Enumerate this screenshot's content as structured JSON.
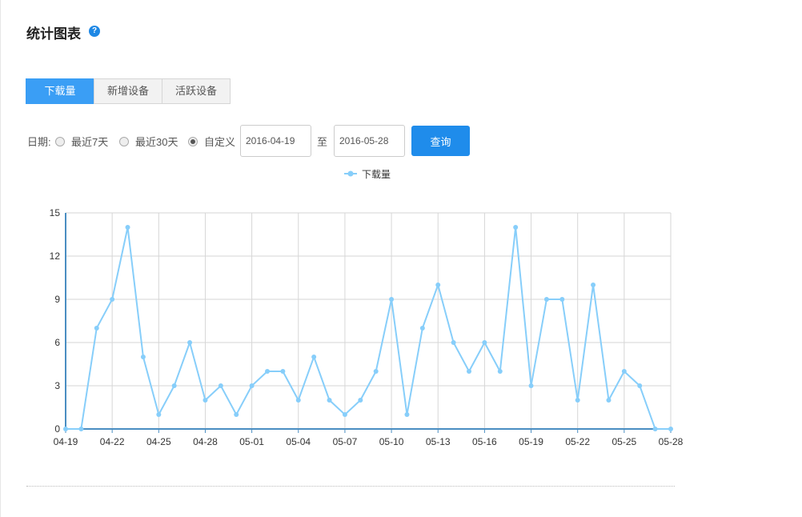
{
  "header": {
    "title": "统计图表",
    "help_glyph": "?"
  },
  "tabs": [
    {
      "label": "下载量",
      "active": true
    },
    {
      "label": "新增设备",
      "active": false
    },
    {
      "label": "活跃设备",
      "active": false
    }
  ],
  "filter": {
    "date_label": "日期:",
    "options": [
      {
        "label": "最近7天",
        "checked": false
      },
      {
        "label": "最近30天",
        "checked": false
      },
      {
        "label": "自定义",
        "checked": true
      }
    ],
    "start_date": "2016-04-19",
    "to_label": "至",
    "end_date": "2016-05-28",
    "query_label": "查询"
  },
  "chart_data": {
    "type": "line",
    "legend_position": "top-center",
    "grid": true,
    "ylim": [
      0,
      15
    ],
    "y_ticks": [
      "0",
      "3",
      "6",
      "9",
      "12",
      "15"
    ],
    "x_tick_labels": [
      "04-19",
      "04-22",
      "04-25",
      "04-28",
      "05-01",
      "05-04",
      "05-07",
      "05-10",
      "05-13",
      "05-16",
      "05-19",
      "05-22",
      "05-25",
      "05-28"
    ],
    "x": [
      "04-19",
      "04-20",
      "04-21",
      "04-22",
      "04-23",
      "04-24",
      "04-25",
      "04-26",
      "04-27",
      "04-28",
      "04-29",
      "04-30",
      "05-01",
      "05-02",
      "05-03",
      "05-04",
      "05-05",
      "05-06",
      "05-07",
      "05-08",
      "05-09",
      "05-10",
      "05-11",
      "05-12",
      "05-13",
      "05-14",
      "05-15",
      "05-16",
      "05-17",
      "05-18",
      "05-19",
      "05-20",
      "05-21",
      "05-22",
      "05-23",
      "05-24",
      "05-25",
      "05-26",
      "05-27",
      "05-28"
    ],
    "series": [
      {
        "name": "下载量",
        "color": "#87cefa",
        "values": [
          0,
          0,
          7,
          9,
          14,
          5,
          1,
          3,
          6,
          2,
          3,
          1,
          3,
          4,
          4,
          2,
          5,
          2,
          1,
          2,
          4,
          9,
          1,
          7,
          10,
          6,
          4,
          6,
          4,
          14,
          3,
          9,
          9,
          2,
          10,
          2,
          4,
          3,
          0,
          0
        ]
      }
    ]
  }
}
